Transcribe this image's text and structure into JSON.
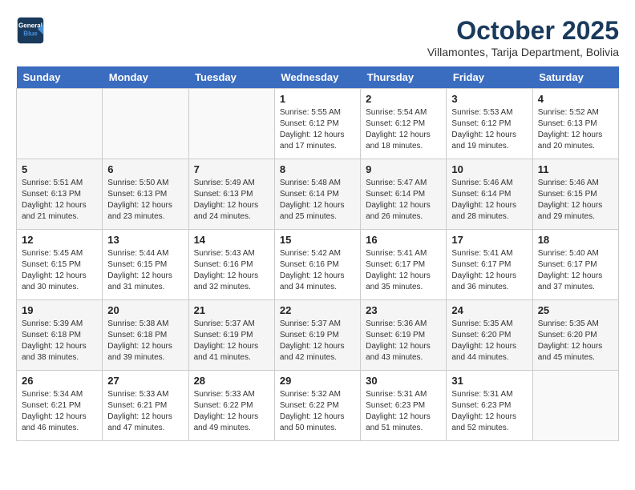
{
  "header": {
    "logo_line1": "General",
    "logo_line2": "Blue",
    "month_title": "October 2025",
    "location": "Villamontes, Tarija Department, Bolivia"
  },
  "weekdays": [
    "Sunday",
    "Monday",
    "Tuesday",
    "Wednesday",
    "Thursday",
    "Friday",
    "Saturday"
  ],
  "weeks": [
    [
      {
        "day": "",
        "sunrise": "",
        "sunset": "",
        "daylight": ""
      },
      {
        "day": "",
        "sunrise": "",
        "sunset": "",
        "daylight": ""
      },
      {
        "day": "",
        "sunrise": "",
        "sunset": "",
        "daylight": ""
      },
      {
        "day": "1",
        "sunrise": "Sunrise: 5:55 AM",
        "sunset": "Sunset: 6:12 PM",
        "daylight": "Daylight: 12 hours and 17 minutes."
      },
      {
        "day": "2",
        "sunrise": "Sunrise: 5:54 AM",
        "sunset": "Sunset: 6:12 PM",
        "daylight": "Daylight: 12 hours and 18 minutes."
      },
      {
        "day": "3",
        "sunrise": "Sunrise: 5:53 AM",
        "sunset": "Sunset: 6:12 PM",
        "daylight": "Daylight: 12 hours and 19 minutes."
      },
      {
        "day": "4",
        "sunrise": "Sunrise: 5:52 AM",
        "sunset": "Sunset: 6:13 PM",
        "daylight": "Daylight: 12 hours and 20 minutes."
      }
    ],
    [
      {
        "day": "5",
        "sunrise": "Sunrise: 5:51 AM",
        "sunset": "Sunset: 6:13 PM",
        "daylight": "Daylight: 12 hours and 21 minutes."
      },
      {
        "day": "6",
        "sunrise": "Sunrise: 5:50 AM",
        "sunset": "Sunset: 6:13 PM",
        "daylight": "Daylight: 12 hours and 23 minutes."
      },
      {
        "day": "7",
        "sunrise": "Sunrise: 5:49 AM",
        "sunset": "Sunset: 6:13 PM",
        "daylight": "Daylight: 12 hours and 24 minutes."
      },
      {
        "day": "8",
        "sunrise": "Sunrise: 5:48 AM",
        "sunset": "Sunset: 6:14 PM",
        "daylight": "Daylight: 12 hours and 25 minutes."
      },
      {
        "day": "9",
        "sunrise": "Sunrise: 5:47 AM",
        "sunset": "Sunset: 6:14 PM",
        "daylight": "Daylight: 12 hours and 26 minutes."
      },
      {
        "day": "10",
        "sunrise": "Sunrise: 5:46 AM",
        "sunset": "Sunset: 6:14 PM",
        "daylight": "Daylight: 12 hours and 28 minutes."
      },
      {
        "day": "11",
        "sunrise": "Sunrise: 5:46 AM",
        "sunset": "Sunset: 6:15 PM",
        "daylight": "Daylight: 12 hours and 29 minutes."
      }
    ],
    [
      {
        "day": "12",
        "sunrise": "Sunrise: 5:45 AM",
        "sunset": "Sunset: 6:15 PM",
        "daylight": "Daylight: 12 hours and 30 minutes."
      },
      {
        "day": "13",
        "sunrise": "Sunrise: 5:44 AM",
        "sunset": "Sunset: 6:15 PM",
        "daylight": "Daylight: 12 hours and 31 minutes."
      },
      {
        "day": "14",
        "sunrise": "Sunrise: 5:43 AM",
        "sunset": "Sunset: 6:16 PM",
        "daylight": "Daylight: 12 hours and 32 minutes."
      },
      {
        "day": "15",
        "sunrise": "Sunrise: 5:42 AM",
        "sunset": "Sunset: 6:16 PM",
        "daylight": "Daylight: 12 hours and 34 minutes."
      },
      {
        "day": "16",
        "sunrise": "Sunrise: 5:41 AM",
        "sunset": "Sunset: 6:17 PM",
        "daylight": "Daylight: 12 hours and 35 minutes."
      },
      {
        "day": "17",
        "sunrise": "Sunrise: 5:41 AM",
        "sunset": "Sunset: 6:17 PM",
        "daylight": "Daylight: 12 hours and 36 minutes."
      },
      {
        "day": "18",
        "sunrise": "Sunrise: 5:40 AM",
        "sunset": "Sunset: 6:17 PM",
        "daylight": "Daylight: 12 hours and 37 minutes."
      }
    ],
    [
      {
        "day": "19",
        "sunrise": "Sunrise: 5:39 AM",
        "sunset": "Sunset: 6:18 PM",
        "daylight": "Daylight: 12 hours and 38 minutes."
      },
      {
        "day": "20",
        "sunrise": "Sunrise: 5:38 AM",
        "sunset": "Sunset: 6:18 PM",
        "daylight": "Daylight: 12 hours and 39 minutes."
      },
      {
        "day": "21",
        "sunrise": "Sunrise: 5:37 AM",
        "sunset": "Sunset: 6:19 PM",
        "daylight": "Daylight: 12 hours and 41 minutes."
      },
      {
        "day": "22",
        "sunrise": "Sunrise: 5:37 AM",
        "sunset": "Sunset: 6:19 PM",
        "daylight": "Daylight: 12 hours and 42 minutes."
      },
      {
        "day": "23",
        "sunrise": "Sunrise: 5:36 AM",
        "sunset": "Sunset: 6:19 PM",
        "daylight": "Daylight: 12 hours and 43 minutes."
      },
      {
        "day": "24",
        "sunrise": "Sunrise: 5:35 AM",
        "sunset": "Sunset: 6:20 PM",
        "daylight": "Daylight: 12 hours and 44 minutes."
      },
      {
        "day": "25",
        "sunrise": "Sunrise: 5:35 AM",
        "sunset": "Sunset: 6:20 PM",
        "daylight": "Daylight: 12 hours and 45 minutes."
      }
    ],
    [
      {
        "day": "26",
        "sunrise": "Sunrise: 5:34 AM",
        "sunset": "Sunset: 6:21 PM",
        "daylight": "Daylight: 12 hours and 46 minutes."
      },
      {
        "day": "27",
        "sunrise": "Sunrise: 5:33 AM",
        "sunset": "Sunset: 6:21 PM",
        "daylight": "Daylight: 12 hours and 47 minutes."
      },
      {
        "day": "28",
        "sunrise": "Sunrise: 5:33 AM",
        "sunset": "Sunset: 6:22 PM",
        "daylight": "Daylight: 12 hours and 49 minutes."
      },
      {
        "day": "29",
        "sunrise": "Sunrise: 5:32 AM",
        "sunset": "Sunset: 6:22 PM",
        "daylight": "Daylight: 12 hours and 50 minutes."
      },
      {
        "day": "30",
        "sunrise": "Sunrise: 5:31 AM",
        "sunset": "Sunset: 6:23 PM",
        "daylight": "Daylight: 12 hours and 51 minutes."
      },
      {
        "day": "31",
        "sunrise": "Sunrise: 5:31 AM",
        "sunset": "Sunset: 6:23 PM",
        "daylight": "Daylight: 12 hours and 52 minutes."
      },
      {
        "day": "",
        "sunrise": "",
        "sunset": "",
        "daylight": ""
      }
    ]
  ]
}
